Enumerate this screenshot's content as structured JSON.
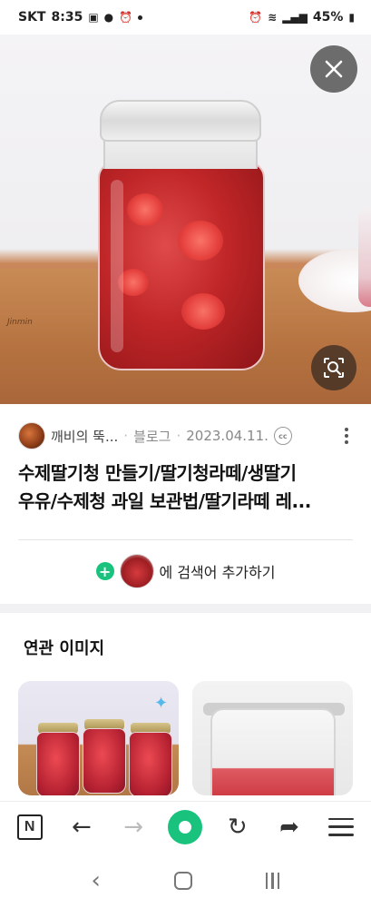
{
  "status_bar": {
    "carrier": "SKT",
    "time": "8:35",
    "battery": "45%"
  },
  "hero": {
    "jar_brand_text": "Jinmin",
    "close_icon": "close-icon",
    "lens_icon": "image-search-icon"
  },
  "post": {
    "author": "깨비의 뚝...",
    "separator": "·",
    "source": "블로그",
    "date": "2023.04.11.",
    "license_badge": "cc",
    "title_line1": "수제딸기청 만들기/딸기청라떼/생딸기",
    "title_line2": "우유/수제청 과일 보관법/딸기라떼 레..."
  },
  "add_search": {
    "label": "에 검색어 추가하기",
    "plus_symbol": "+"
  },
  "related": {
    "title": "연관 이미지"
  },
  "toolbar": {
    "n_logo": "N",
    "back": "←",
    "forward": "→",
    "reload": "↻",
    "share": "➦"
  },
  "system_nav": {
    "back": "‹"
  },
  "colors": {
    "accent_green": "#19c37d",
    "jam_red": "#c02628"
  }
}
